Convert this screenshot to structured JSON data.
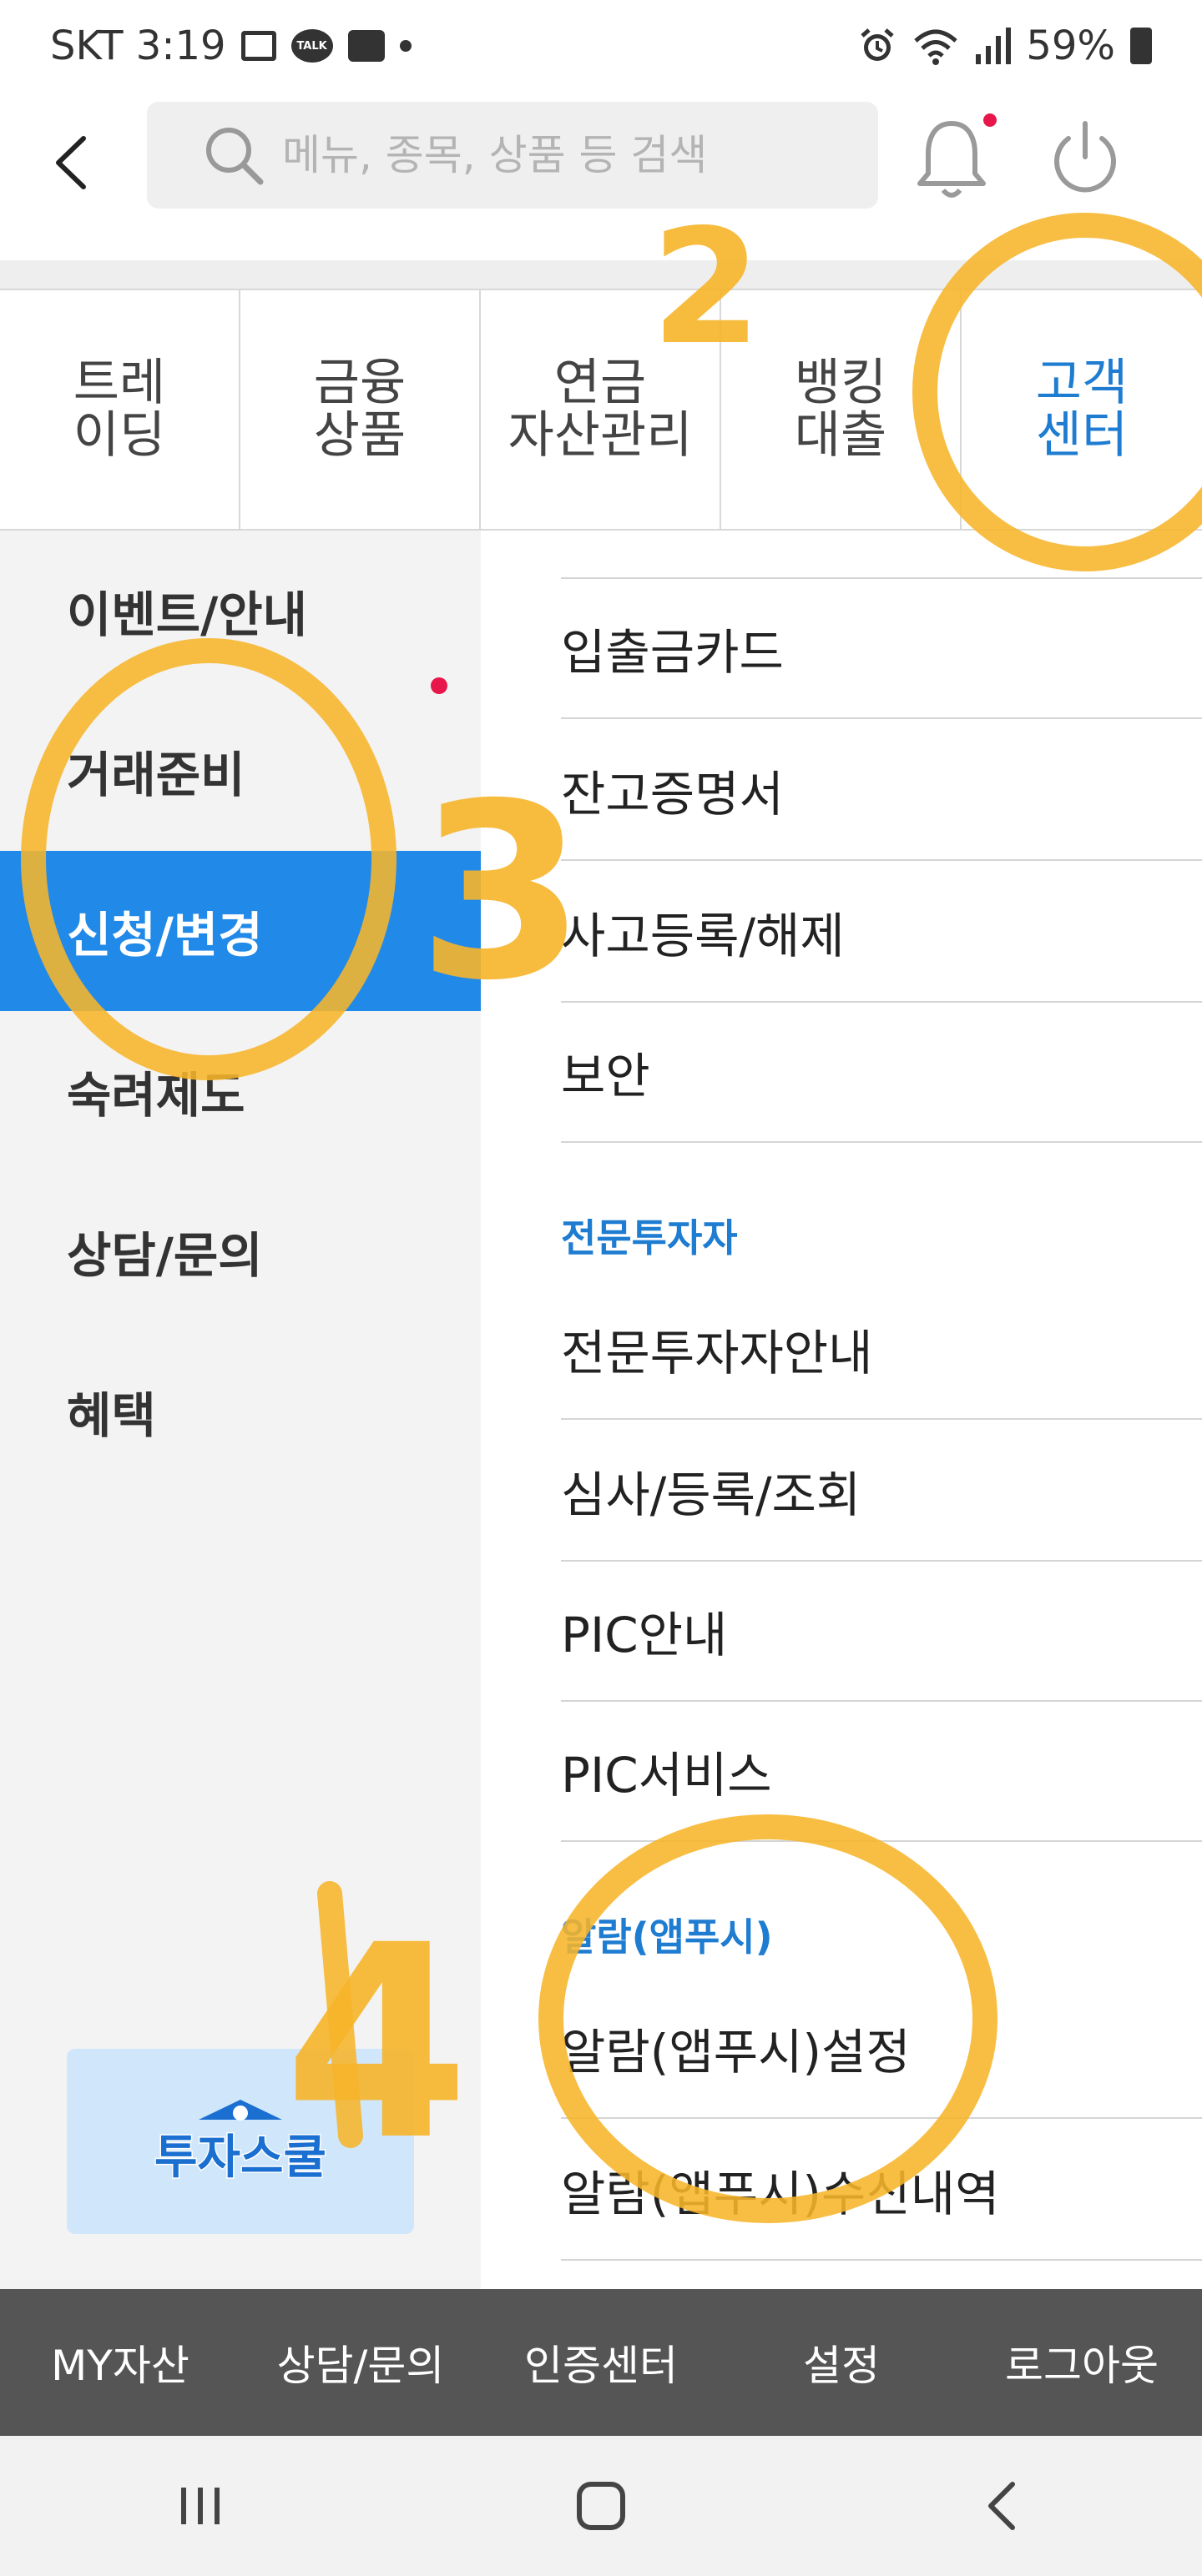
{
  "status_bar": {
    "carrier_time": "SKT 3:19",
    "battery": "59%"
  },
  "header": {
    "search_placeholder": "메뉴, 종목, 상품 등 검색"
  },
  "tabs": [
    {
      "label": "트레\n이딩"
    },
    {
      "label": "금융\n상품"
    },
    {
      "label": "연금\n자산관리"
    },
    {
      "label": "뱅킹\n대출"
    },
    {
      "label": "고객\n센터",
      "active": true
    }
  ],
  "left_menu": [
    {
      "label": "이벤트/안내"
    },
    {
      "label": "거래준비"
    },
    {
      "label": "신청/변경",
      "active": true
    },
    {
      "label": "숙려제도"
    },
    {
      "label": "상담/문의"
    },
    {
      "label": "혜택"
    }
  ],
  "education_banner": {
    "label": "투자스쿨"
  },
  "right_list": {
    "items_group1": [
      "입출금카드",
      "잔고증명서",
      "사고등록/해제",
      "보안"
    ],
    "section2_title": "전문투자자",
    "items_group2": [
      "전문투자자안내",
      "심사/등록/조회",
      "PIC안내",
      "PIC서비스"
    ],
    "section3_title": "알람(앱푸시)",
    "items_group3": [
      "알람(앱푸시)설정",
      "알람(앱푸시)수신내역"
    ]
  },
  "annotations": [
    "2",
    "3",
    "4"
  ],
  "bottom_bar": [
    "MY자산",
    "상담/문의",
    "인증센터",
    "설정",
    "로그아웃"
  ],
  "colors": {
    "accent": "#2189e8",
    "accent_text": "#1e7cd1",
    "annotation": "#f7b52a",
    "notify_dot": "#e8174b",
    "bottom_bar": "#555555"
  }
}
